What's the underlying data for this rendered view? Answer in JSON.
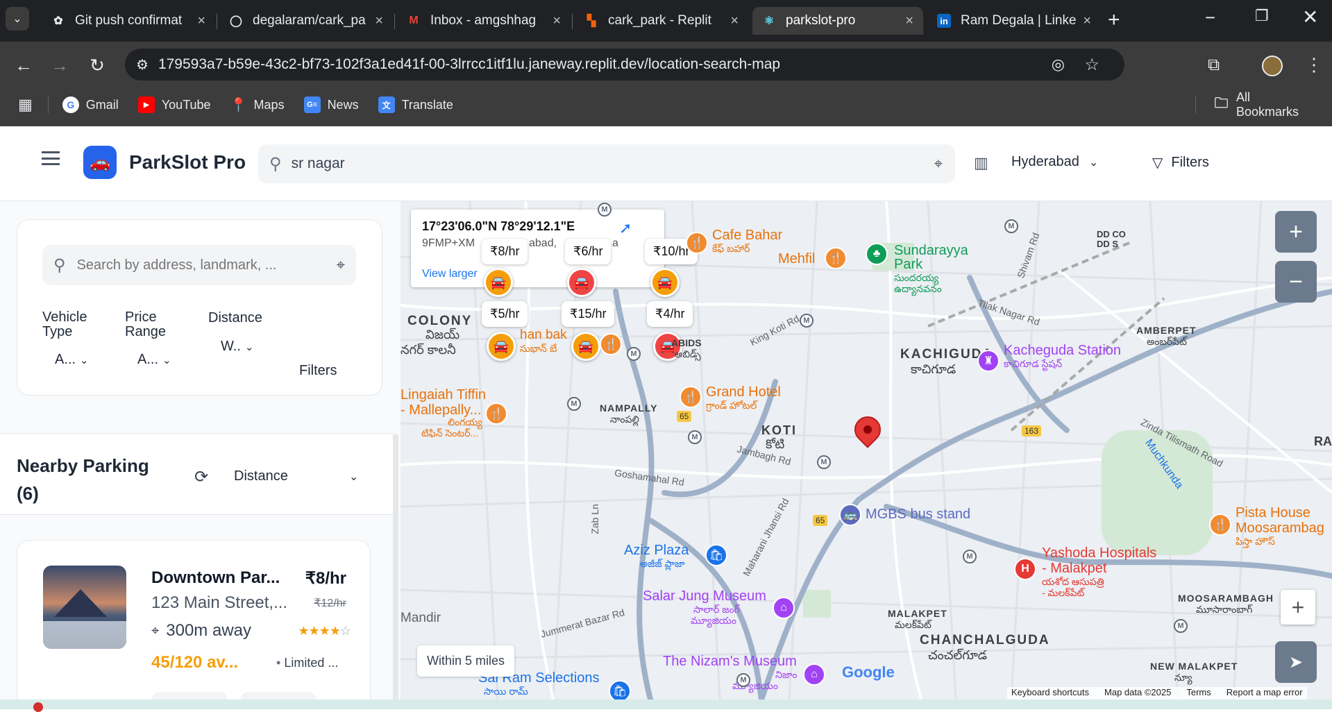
{
  "browser": {
    "tabs": [
      {
        "title": "Git push confirmat",
        "icon": "openai-icon",
        "color": "#e8eaed"
      },
      {
        "title": "degalaram/cark_pa",
        "icon": "github-icon",
        "color": "#e8eaed"
      },
      {
        "title": "Inbox - amgshhag",
        "icon": "gmail-icon",
        "color": "#ea4335"
      },
      {
        "title": "cark_park - Replit",
        "icon": "replit-icon",
        "color": "#f26207"
      },
      {
        "title": "parkslot-pro",
        "icon": "react-icon",
        "color": "#61dafb"
      },
      {
        "title": "Ram Degala | Linke",
        "icon": "linkedin-icon",
        "color": "#0a66c2"
      }
    ],
    "url": "179593a7-b59e-43c2-bf73-102f3a1ed41f-00-3lrrcc1itf1lu.janeway.replit.dev/location-search-map",
    "bookmarks": [
      {
        "label": "Gmail",
        "icon": "google-icon",
        "color": "#4285f4"
      },
      {
        "label": "YouTube",
        "icon": "youtube-icon",
        "color": "#ff0000"
      },
      {
        "label": "Maps",
        "icon": "maps-icon",
        "color": "#34a853"
      },
      {
        "label": "News",
        "icon": "news-icon",
        "color": "#4285f4"
      },
      {
        "label": "Translate",
        "icon": "translate-icon",
        "color": "#4285f4"
      }
    ],
    "all_bookmarks": "All Bookmarks"
  },
  "header": {
    "app_name": "ParkSlot Pro",
    "search_value": "sr nagar",
    "city": "Hyderabad",
    "filters_label": "Filters",
    "accent": "#2563eb"
  },
  "sidebar": {
    "search_placeholder": "Search by address, landmark, ...",
    "filters": [
      {
        "label": "Vehicle Type",
        "value": "A..."
      },
      {
        "label": "Price Range",
        "value": "A..."
      },
      {
        "label": "Distance",
        "value": "W.."
      }
    ],
    "filters_button": "Filters",
    "nearby_title": "Nearby Parking",
    "nearby_count": "(6)",
    "sort_value": "Distance",
    "listing": {
      "name": "Downtown Par...",
      "address": "123 Main Street,...",
      "price": "₹8/hr",
      "old_price": "₹12/hr",
      "distance": "300m away",
      "rating": 4,
      "availability": "45/120 av...",
      "status": "Limited ..."
    }
  },
  "map": {
    "info_popup": {
      "coords": "17°23'06.0\"N 78°29'12.1\"E",
      "plus_code": "9FMP+XM",
      "partial_text_1": "abad,",
      "partial_text_2": "a",
      "partial_text_3": "s",
      "link": "View larger"
    },
    "price_tags": [
      "₹8/hr",
      "₹6/hr",
      "₹10/hr",
      "₹5/hr",
      "₹15/hr",
      "₹4/hr"
    ],
    "pin_colors": {
      "available": "#f59e0b",
      "full": "#ef4444"
    },
    "places": {
      "cafe_bahar": "Cafe Bahar",
      "cafe_bahar_te": "కేఫ్ బహార్",
      "mehfil": "Mehfil",
      "sundarayya": "Sundarayya",
      "park": "Park",
      "sundarayya_te": "సుందరయ్య",
      "udyanavanam_te": "ఉద్యానవనం",
      "colony": "COLONY",
      "colony_te": "విజయ్",
      "nagar_te": "నగర్ కాలనీ",
      "han_bak": "han bak",
      "han_bak_te": "సుభాన్ బే",
      "abids": "ABIDS",
      "abids_te": "అబిడ్స్",
      "king_koti": "King Koti Rd",
      "tilak": "Tilak Nagar Rd",
      "shivam": "Shivam Rd",
      "amberpet": "AMBERPET",
      "amberpet_te": "అంబర్‌పేట్",
      "kachiguda": "KACHIGUDA",
      "kachiguda_te": "కాచిగూడ",
      "kachiguda_station": "Kacheguda Station",
      "kachiguda_station_te": "కాచిగూడ స్టేషన్",
      "lingaiah_1": "Lingaiah Tiffin",
      "lingaiah_2": "- Mallepally...",
      "lingaiah_te1": "లింగయ్య",
      "lingaiah_te2": "టిఫిన్ సెంటర్...",
      "nampally": "NAMPALLY",
      "nampally_te": "నాంపల్లి",
      "grand_hotel": "Grand Hotel",
      "grand_hotel_te": "గ్రాండ్ హోటల్",
      "koti": "KOTI",
      "koti_te": "కోటి",
      "zinda": "Zinda Tilismath Road",
      "muchkunda": "Muchkunda",
      "dd_co": "DD CO",
      "dd_co2": "DD S",
      "ra": "RA",
      "jambagh": "Jambagh Rd",
      "goshamahal": "Goshamahal Rd",
      "zab": "Zab Ln",
      "mgbs": "MGBS bus stand",
      "pista": "Pista House",
      "moosarambag": "Moosarambag",
      "pista_te": "పిస్తా హౌస్",
      "aziz": "Aziz Plaza",
      "aziz_te": "అజీజ్ ప్లాజా",
      "maharani": "Maharani Jhansi Rd",
      "yashoda": "Yashoda Hospitals",
      "yashoda2": "- Malakpet",
      "yashoda_te": "యశోద ఆసుపత్రి",
      "yashoda_te2": "- మలక్‌పేట్",
      "salarjung": "Salar Jung Museum",
      "salarjung_te": "సాలార్ జంగ్",
      "salarjung_te2": "మ్యూజియం",
      "moosarambagh": "MOOSARAMBAGH",
      "moosarambagh_te": "మూసారాంబాగ్",
      "mandir": "Mandir",
      "jummerat": "Jummerat Bazar Rd",
      "malakpet": "MALAKPET",
      "malakpet_te": "మలక్‌పేట్",
      "chanchalguda": "CHANCHALGUDA",
      "chanchalguda_te": "చంచల్‌గూడ",
      "nizams": "The Nizam's Museum",
      "nizams_te": "నిజాం",
      "nizams_te2": "మ్యూజియం",
      "new_malakpet": "NEW MALAKPET",
      "new_malakpet_te": "న్యూ",
      "sai_ram": "Sai Ram Selections",
      "sai_ram_te": "సాయి రామ్",
      "route_65": "65",
      "route_163": "163"
    },
    "radius_label": "Within 5 miles",
    "google": "Google",
    "footer": [
      "Keyboard shortcuts",
      "Map data ©2025",
      "Terms",
      "Report a map error"
    ]
  }
}
